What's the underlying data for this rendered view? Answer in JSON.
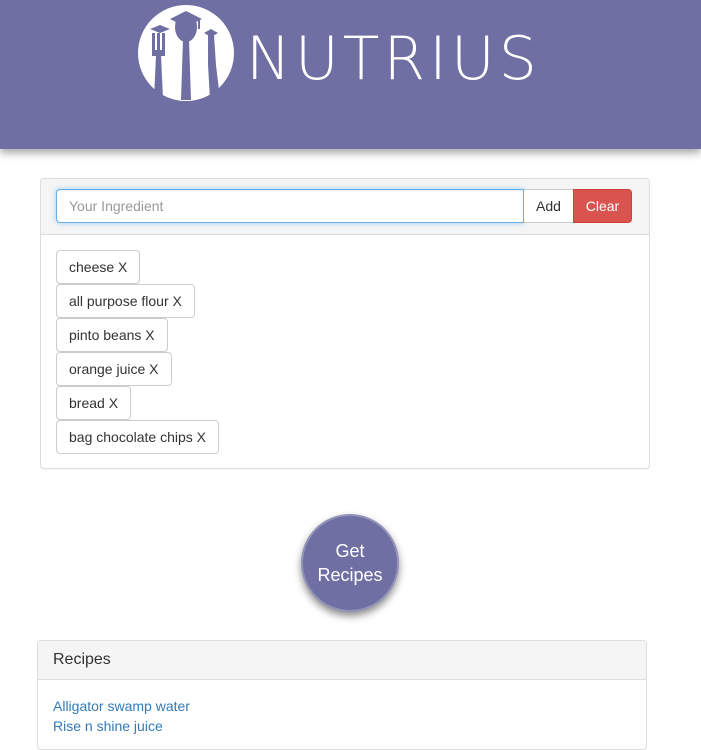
{
  "header": {
    "brand": "NUTRIUS",
    "logo_icon": "utensils-graduation-cap-logo",
    "background_color": "#6f6fa3"
  },
  "ingredient_form": {
    "placeholder": "Your Ingredient",
    "value": "",
    "add_label": "Add",
    "clear_label": "Clear",
    "clear_color": "#d9534f"
  },
  "ingredients": [
    "cheese X",
    "all purpose flour X",
    "pinto beans X",
    "orange juice X",
    "bread X",
    "bag chocolate chips X"
  ],
  "get_recipes": {
    "line1": "Get",
    "line2": "Recipes"
  },
  "recipes": {
    "title": "Recipes",
    "items": [
      "Alligator swamp water",
      "Rise n shine juice"
    ],
    "link_color": "#337ab7"
  }
}
